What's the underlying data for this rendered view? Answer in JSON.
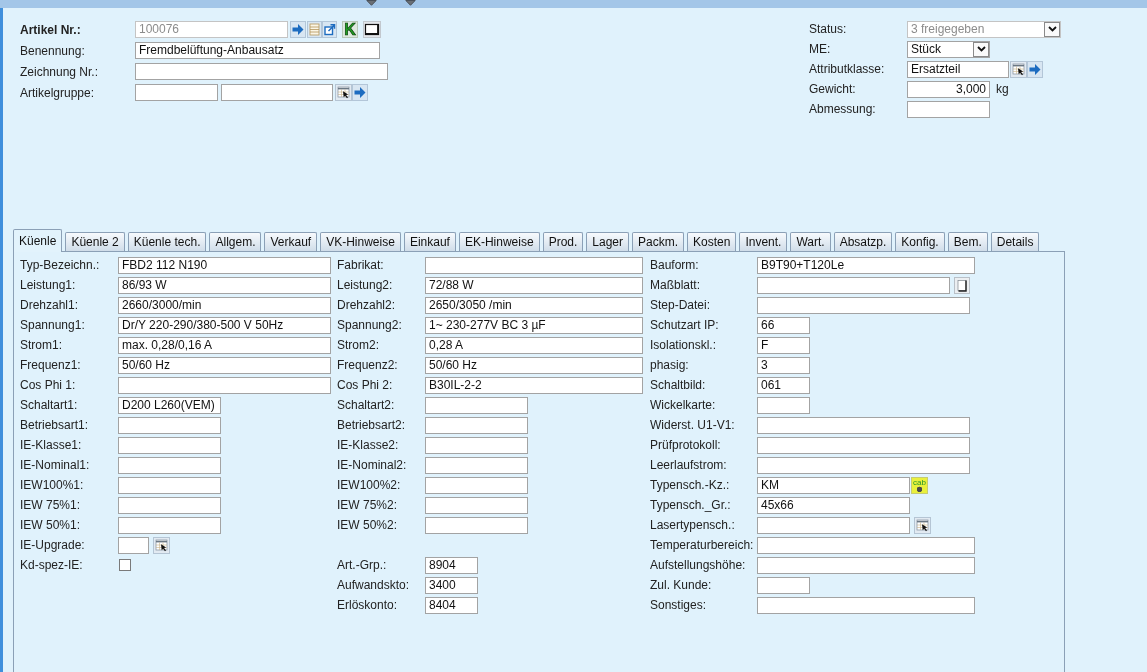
{
  "header": {
    "left": [
      {
        "kind": "id_field",
        "label": "Artikel Nr.:",
        "value": "100076",
        "disabled": true,
        "toolbar": [
          {
            "kind": "arrow"
          },
          {
            "kind": "list"
          },
          {
            "kind": "open"
          },
          {
            "kind": "letter",
            "text": "K"
          },
          {
            "kind": "window"
          }
        ]
      },
      {
        "kind": "text",
        "label": "Benennung:",
        "value": "Fremdbelüftung-Anbausatz",
        "disabled": false
      },
      {
        "kind": "text",
        "label": "Zeichnung Nr.:",
        "disabled": false
      },
      {
        "kind": "group",
        "label": "Artikelgruppe:",
        "disabled": false
      }
    ],
    "right": [
      {
        "kind": "select",
        "label": "Status:",
        "value": "3 freigegeben",
        "disabled": true
      },
      {
        "kind": "select",
        "label": "ME:",
        "value": "Stück",
        "disabled": false
      },
      {
        "kind": "lookup",
        "label": "Attributklasse:",
        "value": "Ersatzteil",
        "disabled": false
      },
      {
        "kind": "number",
        "label": "Gewicht:",
        "value": "3,000",
        "unit": "kg",
        "disabled": false
      },
      {
        "kind": "text",
        "label": "Abmessung:",
        "disabled": false
      }
    ]
  },
  "tabs": [
    {
      "label": "Küenle",
      "selected": true
    },
    {
      "label": "Küenle 2",
      "selected": false
    },
    {
      "label": "Küenle tech.",
      "selected": false
    },
    {
      "label": "Allgem.",
      "selected": false
    },
    {
      "label": "Verkauf",
      "selected": false
    },
    {
      "label": "VK-Hinweise",
      "selected": false
    },
    {
      "label": "Einkauf",
      "selected": false
    },
    {
      "label": "EK-Hinweise",
      "selected": false
    },
    {
      "label": "Prod.",
      "selected": false
    },
    {
      "label": "Lager",
      "selected": false
    },
    {
      "label": "Packm.",
      "selected": false
    },
    {
      "label": "Kosten",
      "selected": false
    },
    {
      "label": "Invent.",
      "selected": false
    },
    {
      "label": "Wart.",
      "selected": false
    },
    {
      "label": "Absatzp.",
      "selected": false
    },
    {
      "label": "Konfig.",
      "selected": false
    },
    {
      "label": "Bem.",
      "selected": false
    },
    {
      "label": "Details",
      "selected": false
    }
  ],
  "tab_panel": {
    "columns": [
      {
        "sections": [
          [
            {
              "kind": "text",
              "label": "Typ-Bezeichn.:",
              "value": "FBD2 112 N190"
            },
            {
              "kind": "text",
              "label": "Leistung1:",
              "value": "86/93 W"
            },
            {
              "kind": "text",
              "label": "Drehzahl1:",
              "value": "2660/3000/min"
            },
            {
              "kind": "text",
              "label": "Spannung1:",
              "value": "Dr/Y 220-290/380-500 V 50Hz"
            },
            {
              "kind": "text",
              "label": "Strom1:",
              "value": "max. 0,28/0,16 A"
            },
            {
              "kind": "text",
              "label": "Frequenz1:",
              "value": "50/60 Hz"
            },
            {
              "kind": "text",
              "label": "Cos Phi 1:"
            },
            {
              "kind": "text",
              "label": "Schaltart1:",
              "value": "D200 L260(VEM)"
            },
            {
              "kind": "text",
              "label": "Betriebsart1:"
            },
            {
              "kind": "text",
              "label": "IE-Klasse1:"
            },
            {
              "kind": "text",
              "label": "IE-Nominal1:"
            },
            {
              "kind": "text",
              "label": "IEW100%1:"
            },
            {
              "kind": "text",
              "label": "IEW 75%1:"
            },
            {
              "kind": "text",
              "label": "IEW 50%1:"
            },
            {
              "kind": "picker",
              "label": "IE-Upgrade:"
            },
            {
              "kind": "checkbox",
              "label": "Kd-spez-IE:",
              "checked": false
            }
          ]
        ]
      },
      {
        "sections": [
          [
            {
              "kind": "text",
              "label": "Fabrikat:"
            },
            {
              "kind": "text",
              "label": "Leistung2:",
              "value": "72/88 W"
            },
            {
              "kind": "text",
              "label": "Drehzahl2:",
              "value": "2650/3050 /min"
            },
            {
              "kind": "text",
              "label": "Spannung2:",
              "value": "1~ 230-277V BC 3 µF"
            },
            {
              "kind": "text",
              "label": "Strom2:",
              "value": "0,28 A"
            },
            {
              "kind": "text",
              "label": "Frequenz2:",
              "value": "50/60 Hz"
            },
            {
              "kind": "text",
              "label": "Cos Phi 2:",
              "value": "B30IL-2-2"
            },
            {
              "kind": "text",
              "label": "Schaltart2:"
            },
            {
              "kind": "text",
              "label": "Betriebsart2:"
            },
            {
              "kind": "text",
              "label": "IE-Klasse2:"
            },
            {
              "kind": "text",
              "label": "IE-Nominal2:"
            },
            {
              "kind": "text",
              "label": "IEW100%2:"
            },
            {
              "kind": "text",
              "label": "IEW 75%2:"
            },
            {
              "kind": "text",
              "label": "IEW 50%2:"
            }
          ],
          [
            {
              "kind": "text",
              "label": "Art.-Grp.:",
              "value": "8904"
            },
            {
              "kind": "text",
              "label": "Aufwandskto:",
              "value": "3400"
            },
            {
              "kind": "text",
              "label": "Erlöskonto:",
              "value": "8404"
            }
          ]
        ]
      },
      {
        "sections": [
          [
            {
              "kind": "text",
              "label": "Bauform:",
              "value": "B9T90+T120Le"
            },
            {
              "kind": "file",
              "label": "Maßblatt:"
            },
            {
              "kind": "text",
              "label": "Step-Datei:"
            },
            {
              "kind": "text",
              "label": "Schutzart IP:",
              "value": "66"
            },
            {
              "kind": "text",
              "label": "Isolationskl.:",
              "value": "F"
            },
            {
              "kind": "text",
              "label": "phasig:",
              "value": "3"
            },
            {
              "kind": "text",
              "label": "Schaltbild:",
              "value": "061"
            },
            {
              "kind": "text",
              "label": "Wickelkarte:"
            },
            {
              "kind": "text",
              "label": "Widerst. U1-V1:"
            },
            {
              "kind": "text",
              "label": "Prüfprotokoll:"
            },
            {
              "kind": "text",
              "label": "Leerlaufstrom:"
            },
            {
              "kind": "tag",
              "label": "Typensch.-Kz.:",
              "value": "KM",
              "tag": "cab"
            },
            {
              "kind": "text",
              "label": "Typensch._Gr.:",
              "value": "45x66"
            },
            {
              "kind": "picker",
              "label": "Lasertypensch.:"
            },
            {
              "kind": "text",
              "label": "Temperaturbereich:"
            },
            {
              "kind": "text",
              "label": "Aufstellungshöhe:"
            },
            {
              "kind": "text",
              "label": "Zul. Kunde:"
            },
            {
              "kind": "text",
              "label": "Sonstiges:"
            }
          ]
        ]
      }
    ]
  }
}
